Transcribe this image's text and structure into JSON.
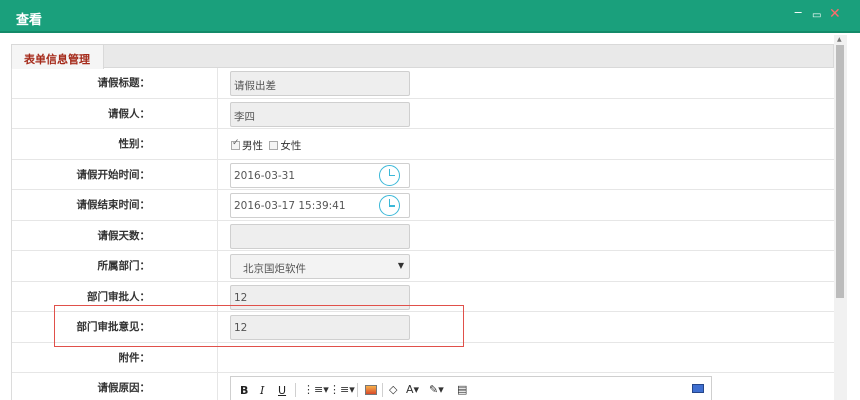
{
  "window": {
    "title": "查看",
    "minimize_glyph": "‒",
    "maximize_glyph": "▭",
    "close_glyph": "✕"
  },
  "tab": {
    "label": "表单信息管理"
  },
  "form": {
    "title_label": "请假标题：",
    "title_value": "请假出差",
    "applicant_label": "请假人：",
    "applicant_value": "李四",
    "gender_label": "性别：",
    "gender_male": "男性",
    "gender_female": "女性",
    "start_label": "请假开始时间：",
    "start_value": "2016-03-31",
    "end_label": "请假结束时间：",
    "end_value": "2016-03-17 15:39:41",
    "days_label": "请假天数：",
    "days_value": "",
    "dept_label": "所属部门：",
    "dept_value": "北京国炬软件",
    "approver_label": "部门审批人：",
    "approver_value": "12",
    "opinion_label": "部门审批意见：",
    "opinion_value": "12",
    "attachment_label": "附件：",
    "reason_label": "请假原因："
  },
  "editor": {
    "bold": "B",
    "italic": "I",
    "underline": "U",
    "ordered_list": "⋮≡▾",
    "bullet_list": "⋮≡▾",
    "font_color": "A▾",
    "highlight": "✎▾",
    "eraser": "◇"
  },
  "colors": {
    "titlebar": "#1aa07c",
    "tab_text": "#a52a1a",
    "highlight_box": "#e0504a",
    "clock": "#3ab8d8"
  }
}
